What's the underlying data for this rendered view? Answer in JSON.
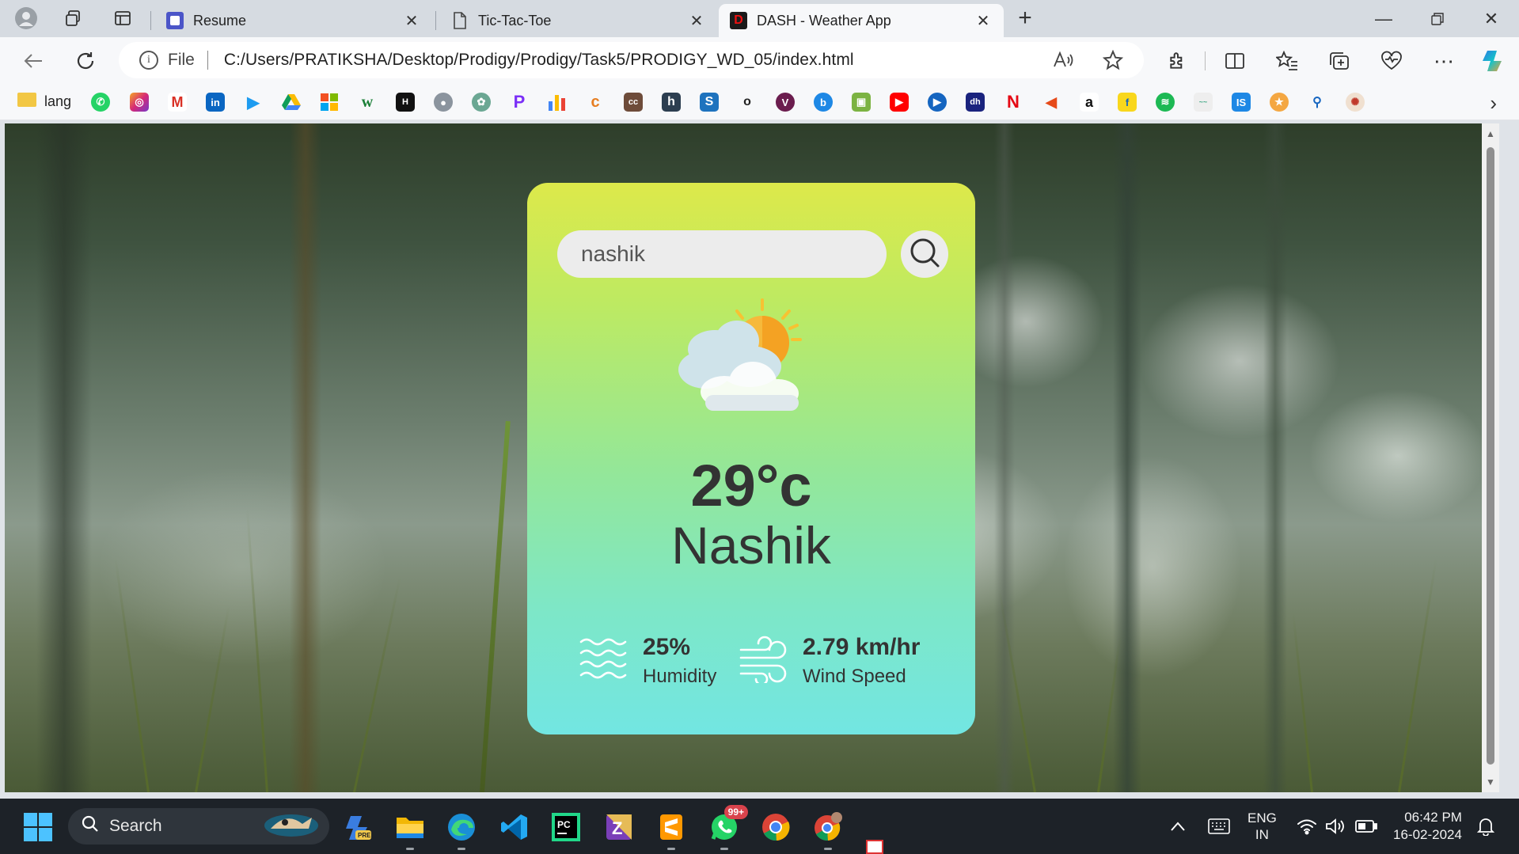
{
  "browser": {
    "tabs": [
      {
        "title": "Resume",
        "active": false
      },
      {
        "title": "Tic-Tac-Toe",
        "active": false
      },
      {
        "title": "DASH - Weather App",
        "active": true
      }
    ],
    "address": {
      "scheme_label": "File",
      "url": "C:/Users/PRATIKSHA/Desktop/Prodigy/Prodigy/Task5/PRODIGY_WD_05/index.html"
    },
    "favorites_bar": {
      "folder_label": "lang"
    }
  },
  "app": {
    "search": {
      "value": "nashik"
    },
    "weather_icon": "partly-cloudy-sun-icon",
    "temperature": "29°c",
    "city": "Nashik",
    "humidity": {
      "value": "25%",
      "label": "Humidity"
    },
    "wind": {
      "value": "2.79 km/hr",
      "label": "Wind Speed"
    },
    "colors": {
      "card_top": "#dde94a",
      "card_bottom": "#72e6e2"
    }
  },
  "taskbar": {
    "search_label": "Search",
    "whatsapp_badge": "99+",
    "language": {
      "line1": "ENG",
      "line2": "IN"
    },
    "clock": {
      "time": "06:42 PM",
      "date": "16-02-2024"
    }
  }
}
